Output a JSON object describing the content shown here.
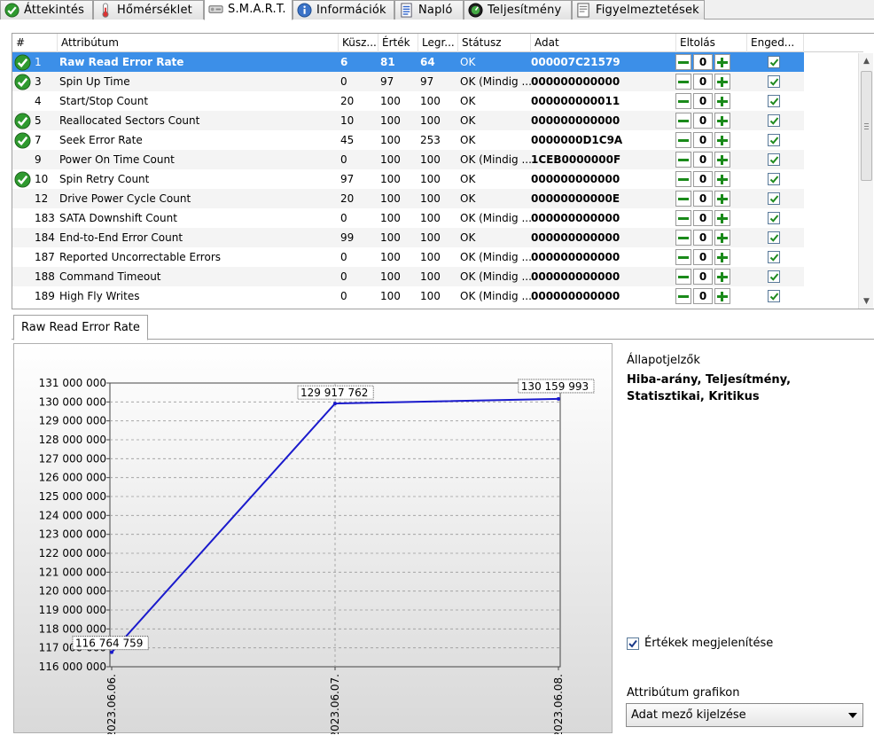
{
  "tabs": [
    {
      "label": "Áttekintés",
      "icon": "check-circle-icon"
    },
    {
      "label": "Hőmérséklet",
      "icon": "thermometer-icon"
    },
    {
      "label": "S.M.A.R.T.",
      "icon": "drive-icon"
    },
    {
      "label": "Információk",
      "icon": "info-icon"
    },
    {
      "label": "Napló",
      "icon": "log-icon"
    },
    {
      "label": "Teljesítmény",
      "icon": "performance-icon"
    },
    {
      "label": "Figyelmeztetések",
      "icon": "warnings-icon"
    }
  ],
  "active_tab": "S.M.A.R.T.",
  "table": {
    "headers": [
      "#",
      "Attribútum",
      "Küsz...",
      "Érték",
      "Legr...",
      "Státusz",
      "Adat",
      "Eltolás",
      "Enged..."
    ],
    "rows": [
      {
        "ok": true,
        "id": "1",
        "name": "Raw Read Error Rate",
        "thr": "6",
        "val": "81",
        "worst": "64",
        "status": "OK",
        "data": "000007C21579",
        "offset": "0",
        "enabled": true,
        "selected": true
      },
      {
        "ok": true,
        "id": "3",
        "name": "Spin Up Time",
        "thr": "0",
        "val": "97",
        "worst": "97",
        "status": "OK (Mindig ...",
        "data": "000000000000",
        "offset": "0",
        "enabled": true
      },
      {
        "ok": false,
        "id": "4",
        "name": "Start/Stop Count",
        "thr": "20",
        "val": "100",
        "worst": "100",
        "status": "OK",
        "data": "000000000011",
        "offset": "0",
        "enabled": true
      },
      {
        "ok": true,
        "id": "5",
        "name": "Reallocated Sectors Count",
        "thr": "10",
        "val": "100",
        "worst": "100",
        "status": "OK",
        "data": "000000000000",
        "offset": "0",
        "enabled": true
      },
      {
        "ok": true,
        "id": "7",
        "name": "Seek Error Rate",
        "thr": "45",
        "val": "100",
        "worst": "253",
        "status": "OK",
        "data": "0000000D1C9A",
        "offset": "0",
        "enabled": true
      },
      {
        "ok": false,
        "id": "9",
        "name": "Power On Time Count",
        "thr": "0",
        "val": "100",
        "worst": "100",
        "status": "OK (Mindig ...",
        "data": "1CEB0000000F",
        "offset": "0",
        "enabled": true
      },
      {
        "ok": true,
        "id": "10",
        "name": "Spin Retry Count",
        "thr": "97",
        "val": "100",
        "worst": "100",
        "status": "OK",
        "data": "000000000000",
        "offset": "0",
        "enabled": true
      },
      {
        "ok": false,
        "id": "12",
        "name": "Drive Power Cycle Count",
        "thr": "20",
        "val": "100",
        "worst": "100",
        "status": "OK",
        "data": "00000000000E",
        "offset": "0",
        "enabled": true
      },
      {
        "ok": false,
        "id": "183",
        "name": "SATA Downshift Count",
        "thr": "0",
        "val": "100",
        "worst": "100",
        "status": "OK (Mindig ...",
        "data": "000000000000",
        "offset": "0",
        "enabled": true
      },
      {
        "ok": false,
        "id": "184",
        "name": "End-to-End Error Count",
        "thr": "99",
        "val": "100",
        "worst": "100",
        "status": "OK",
        "data": "000000000000",
        "offset": "0",
        "enabled": true
      },
      {
        "ok": false,
        "id": "187",
        "name": "Reported Uncorrectable Errors",
        "thr": "0",
        "val": "100",
        "worst": "100",
        "status": "OK (Mindig ...",
        "data": "000000000000",
        "offset": "0",
        "enabled": true
      },
      {
        "ok": false,
        "id": "188",
        "name": "Command Timeout",
        "thr": "0",
        "val": "100",
        "worst": "100",
        "status": "OK (Mindig ...",
        "data": "000000000000",
        "offset": "0",
        "enabled": true
      },
      {
        "ok": false,
        "id": "189",
        "name": "High Fly Writes",
        "thr": "0",
        "val": "100",
        "worst": "100",
        "status": "OK (Mindig ...",
        "data": "000000000000",
        "offset": "0",
        "enabled": true
      }
    ]
  },
  "graph_tab": "Raw Read Error Rate",
  "status_panel": {
    "label": "Állapotjelzők",
    "value": "Hiba-arány, Teljesítmény, Statisztikai, Kritikus",
    "show_values_label": "Értékek megjelenítése",
    "show_values_checked": true,
    "attr_graph_label": "Attribútum grafikon",
    "attr_graph_selected": "Adat mező kijelzése"
  },
  "chart_data": {
    "type": "line",
    "x": [
      "2023.06.06.",
      "2023.06.07.",
      "2023.06.08."
    ],
    "series": [
      {
        "values": [
          116764759,
          129917762,
          130159993
        ]
      }
    ],
    "data_labels": [
      "116 764 759",
      "129 917 762",
      "130 159 993"
    ],
    "yticks": [
      "116 000 000",
      "117 000 000",
      "118 000 000",
      "119 000 000",
      "120 000 000",
      "121 000 000",
      "122 000 000",
      "123 000 000",
      "124 000 000",
      "125 000 000",
      "126 000 000",
      "127 000 000",
      "128 000 000",
      "129 000 000",
      "130 000 000",
      "131 000 000"
    ],
    "ylim": [
      116000000,
      131000000
    ],
    "grid": true,
    "line_color": "#1a1acc"
  }
}
